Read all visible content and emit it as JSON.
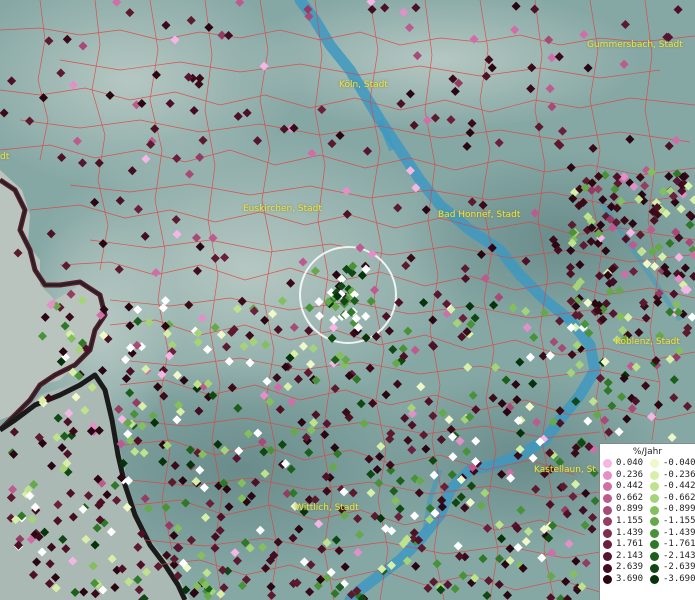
{
  "map": {
    "cities": [
      "Köln, Stadt",
      "Gummersbach, Stadt",
      "Euskirchen, Stadt",
      "Bad Honnef, Stadt",
      "Koblenz, Stadt",
      "Wittlich, Stadt",
      "Kastellaun, St"
    ],
    "partial_label": "dt"
  },
  "legend": {
    "title": "%/Jahr",
    "positive": {
      "values": [
        "0.040",
        "0.236",
        "0.442",
        "0.662",
        "0.899",
        "1.155",
        "1.439",
        "1.761",
        "2.143",
        "2.639",
        "3.690"
      ],
      "colors": [
        "#f4b6e4",
        "#e490c8",
        "#d06ea8",
        "#bd5a8e",
        "#a84a76",
        "#953c62",
        "#7f2c4d",
        "#6b1f3c",
        "#561530",
        "#420c22",
        "#2a0612"
      ]
    },
    "negative": {
      "values": [
        "-0.040",
        "-0.236",
        "-0.442",
        "-0.662",
        "-0.899",
        "-1.155",
        "-1.439",
        "-1.761",
        "-2.143",
        "-2.639",
        "-3.690"
      ],
      "colors": [
        "#f0f7c8",
        "#d8efa8",
        "#bfe38c",
        "#a5d478",
        "#84bf5e",
        "#66a94a",
        "#4a9238",
        "#2f7828",
        "#1c5f1c",
        "#0f4812",
        "#06330a"
      ]
    }
  }
}
